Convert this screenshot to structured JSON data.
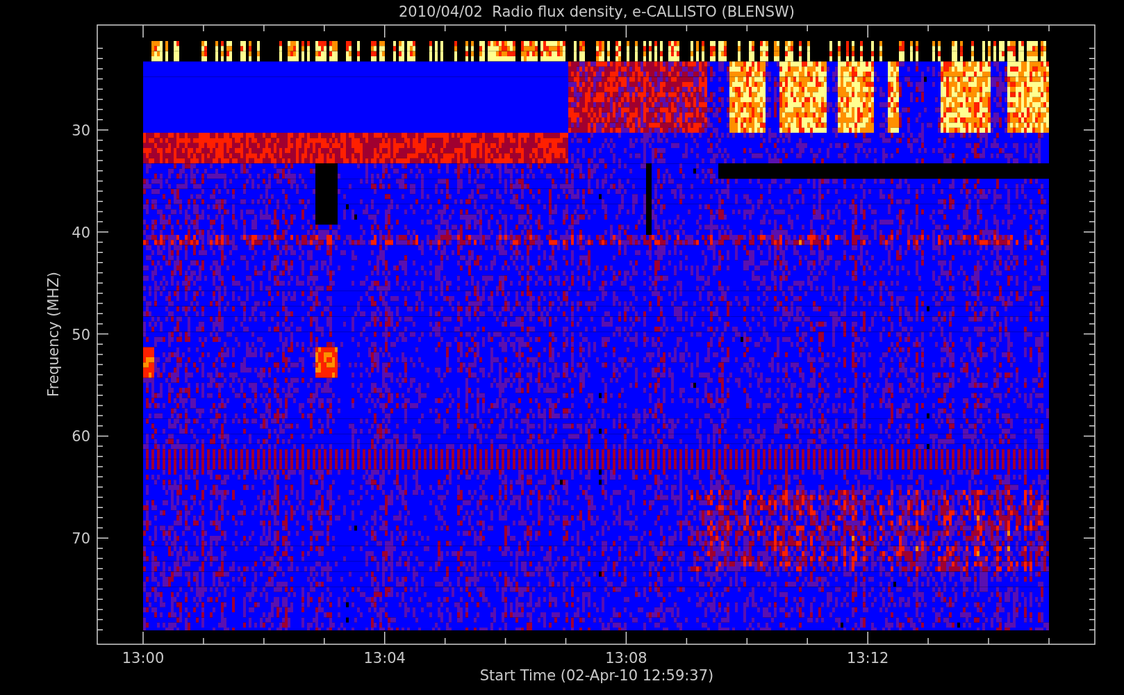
{
  "title": "2010/04/02  Radio flux density, e-CALLISTO (BLENSW)",
  "y_axis": {
    "label": "Frequency (MHZ)",
    "ticks": [
      "30",
      "40",
      "50",
      "60",
      "70"
    ]
  },
  "x_axis": {
    "label": "Start Time (02-Apr-10 12:59:37)",
    "ticks": [
      "13:00",
      "13:04",
      "13:08",
      "13:12"
    ]
  }
}
